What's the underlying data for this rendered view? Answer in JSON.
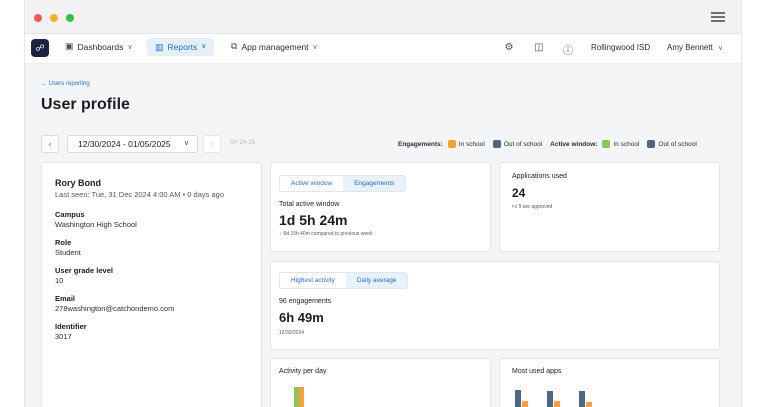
{
  "nav": {
    "dashboards": "Dashboards",
    "reports": "Reports",
    "app_management": "App management",
    "org": "Rollingwood ISD",
    "user": "Amy Bennett"
  },
  "page": {
    "back_link": "← Users reporting",
    "title": "User profile",
    "date_range": "12/30/2024 - 01/05/2025",
    "school_year": "SY 24-25"
  },
  "legend": {
    "engagements_label": "Engagements:",
    "active_window_label": "Active window:",
    "in_school": "In school",
    "out_of_school": "Out of school",
    "colors": {
      "engagement_in_school": "#f5a03a",
      "engagement_out_school": "#4f6680",
      "active_in_school": "#8cc759",
      "active_out_school": "#4f6680"
    }
  },
  "profile": {
    "name": "Rory Bond",
    "last_seen": "Last seen: Tue, 31 Dec 2024 4:00 AM • 0 days ago",
    "fields": [
      {
        "label": "Campus",
        "value": "Washington High School"
      },
      {
        "label": "Role",
        "value": "Student"
      },
      {
        "label": "User grade level",
        "value": "10"
      },
      {
        "label": "Email",
        "value": "278washington@catchondemo.com"
      },
      {
        "label": "Identifier",
        "value": "3017"
      }
    ]
  },
  "active_window": {
    "tabs": [
      "Active window",
      "Engagements"
    ],
    "subtitle": "Total active window",
    "value": "1d 5h 24m",
    "compare": "6d 15h 40m compared to previous week"
  },
  "applications": {
    "title": "Applications used",
    "count": "24",
    "approved": "9 are approved"
  },
  "engagement": {
    "tabs": [
      "Highest activity",
      "Daily average"
    ],
    "subtitle": "96 engagements",
    "value": "6h 49m",
    "date": "12/30/2024"
  },
  "activity_per_day": {
    "title": "Activity per day"
  },
  "most_used_apps": {
    "title": "Most used apps"
  }
}
